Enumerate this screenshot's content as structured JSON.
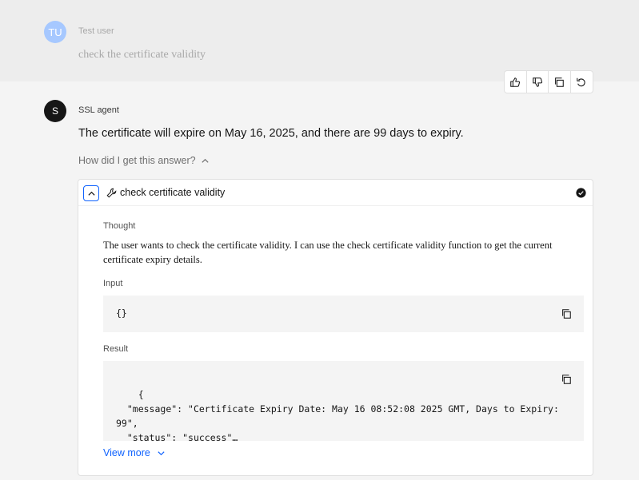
{
  "user": {
    "initials": "TU",
    "name": "Test user",
    "message": "check the certificate validity"
  },
  "agent": {
    "initial": "S",
    "name": "SSL agent",
    "message": "The certificate will expire on May 16, 2025, and there are 99 days to expiry.",
    "how_label": "How did I get this answer?"
  },
  "tool": {
    "title": "check certificate validity",
    "thought_label": "Thought",
    "thought_text": "The user wants to check the certificate validity. I can use the check certificate validity function to get the current certificate expiry details.",
    "input_label": "Input",
    "input_code": "{}",
    "result_label": "Result",
    "result_code": "{\n  \"message\": \"Certificate Expiry Date: May 16 08:52:08 2025 GMT, Days to Expiry: 99\",\n  \"status\": \"success\"…",
    "view_more": "View more"
  },
  "icons": {
    "thumbs_up": "thumbs-up-icon",
    "thumbs_down": "thumbs-down-icon",
    "copy": "copy-icon",
    "regenerate": "regenerate-icon",
    "tool": "wrench-icon",
    "status": "check-circle-icon"
  },
  "colors": {
    "accent": "#0f62fe",
    "user_avatar": "#a6c8ff",
    "agent_avatar": "#161616"
  }
}
